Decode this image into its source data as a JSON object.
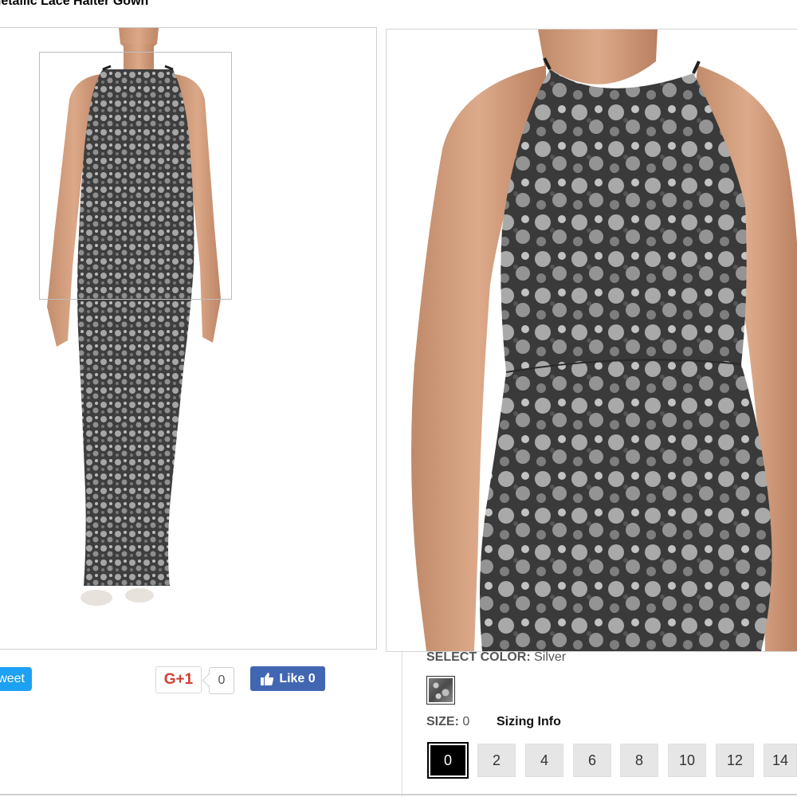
{
  "product": {
    "title": "Metallic Lace Halter Gown"
  },
  "social": {
    "tweet_label": "Tweet",
    "gplus_label": "G+1",
    "gplus_count": "0",
    "fb_like_label": "Like 0"
  },
  "options": {
    "color_label": "SELECT COLOR:",
    "color_value": "Silver",
    "size_label": "SIZE:",
    "size_value": "0",
    "sizing_info": "Sizing Info",
    "sizes": [
      "0",
      "2",
      "4",
      "6",
      "8",
      "10",
      "12",
      "14"
    ],
    "selected_size": "0"
  },
  "colors": {
    "tweet": "#1da1f2",
    "facebook": "#4267b2",
    "google_plus": "#d23f31",
    "selected_size_bg": "#000000",
    "size_bg": "#e6e6e6"
  }
}
